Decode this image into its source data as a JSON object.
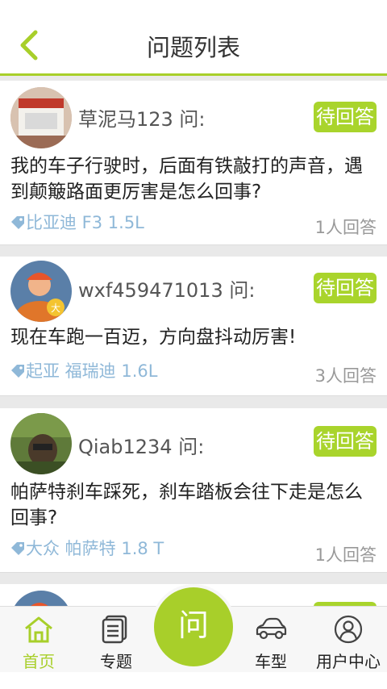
{
  "header": {
    "title": "问题列表",
    "back_icon": "chevron-left-icon",
    "accent": "#a8cf2a"
  },
  "questions": [
    {
      "user": "草泥马123 问:",
      "status": "待回答",
      "text": "我的车子行驶时，后面有铁敲打的声音，遇到颠簸路面更厉害是怎么回事?",
      "car": "比亚迪 F3 1.5L",
      "answers": "1人回答"
    },
    {
      "user": "wxf459471013 问:",
      "status": "待回答",
      "text": "现在车跑一百迈，方向盘抖动厉害!",
      "car": "起亚 福瑞迪 1.6L",
      "answers": "3人回答"
    },
    {
      "user": "Qiab1234 问:",
      "status": "待回答",
      "text": "帕萨特刹车踩死，刹车踏板会往下走是怎么回事?",
      "car": "大众 帕萨特 1.8 T",
      "answers": "1人回答"
    }
  ],
  "tabbar": {
    "home": "首页",
    "topics": "专题",
    "ask": "问",
    "models": "车型",
    "user_center": "用户中心"
  }
}
